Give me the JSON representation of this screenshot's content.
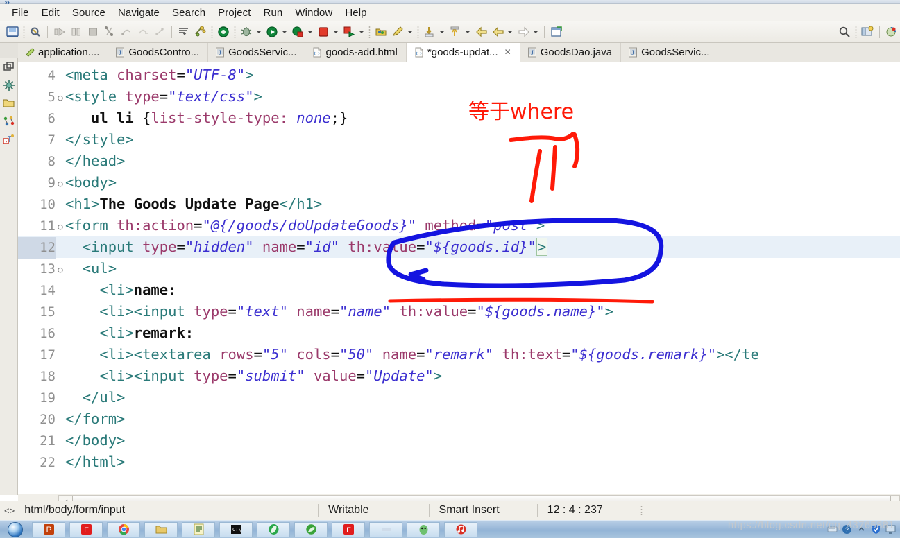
{
  "window": {
    "overflow_chevron": "»"
  },
  "menu": {
    "items": [
      {
        "label": "File",
        "accel": "F"
      },
      {
        "label": "Edit",
        "accel": "E"
      },
      {
        "label": "Source",
        "accel": "S"
      },
      {
        "label": "Navigate",
        "accel": "N"
      },
      {
        "label": "Search",
        "accel": "a"
      },
      {
        "label": "Project",
        "accel": "P"
      },
      {
        "label": "Run",
        "accel": "R"
      },
      {
        "label": "Window",
        "accel": "W"
      },
      {
        "label": "Help",
        "accel": "H"
      }
    ]
  },
  "toolbar": {
    "icons": [
      "save-icon",
      "quick-access-search-icon",
      "step-over-icon",
      "pause-icon",
      "stop-icon",
      "step-into-icon",
      "step-return-icon",
      "resume-icon",
      "disconnect-icon",
      "open-type-icon",
      "open-task-icon",
      "validate-icon",
      "debug-icon",
      "run-icon",
      "coverage-icon",
      "terminate-icon",
      "run-last-icon",
      "new-java-package-icon",
      "new-annotation-icon",
      "download-icon",
      "upload-icon",
      "back-icon",
      "forward-icon",
      "next-icon",
      "new-window-icon"
    ],
    "right_icons": [
      "search-icon",
      "perspective-icon",
      "java-ee-perspective-icon"
    ]
  },
  "rail": {
    "icons": [
      "restore-icon",
      "package-explorer-icon",
      "project-explorer-icon",
      "outline-icon",
      "servers-icon"
    ]
  },
  "tabs": [
    {
      "label": "application....",
      "icon": "properties-file-icon",
      "active": false,
      "dirty": false,
      "closable": false
    },
    {
      "label": "GoodsContro...",
      "icon": "java-file-icon",
      "active": false,
      "dirty": false,
      "closable": false
    },
    {
      "label": "GoodsServic...",
      "icon": "java-file-icon",
      "active": false,
      "dirty": false,
      "closable": false
    },
    {
      "label": "goods-add.html",
      "icon": "html-file-icon",
      "active": false,
      "dirty": false,
      "closable": false
    },
    {
      "label": "*goods-updat...",
      "icon": "html-file-icon",
      "active": true,
      "dirty": true,
      "closable": true,
      "close_glyph": "✕"
    },
    {
      "label": "GoodsDao.java",
      "icon": "java-file-icon",
      "active": false,
      "dirty": false,
      "closable": false
    },
    {
      "label": "GoodsServic...",
      "icon": "java-file-icon",
      "active": false,
      "dirty": false,
      "closable": false
    }
  ],
  "editor": {
    "highlighted_line": 12,
    "lines": [
      {
        "no": "4",
        "fold": "",
        "indent": 0,
        "tokens": [
          {
            "t": "tg",
            "v": "<meta "
          },
          {
            "t": "at",
            "v": "charset"
          },
          {
            "t": "eq",
            "v": "="
          },
          {
            "t": "st",
            "v": "\"UTF-8\""
          },
          {
            "t": "tg",
            "v": ">"
          }
        ]
      },
      {
        "no": "5",
        "fold": "⊖",
        "indent": 0,
        "tokens": [
          {
            "t": "tg",
            "v": "<style "
          },
          {
            "t": "at",
            "v": "type"
          },
          {
            "t": "eq",
            "v": "="
          },
          {
            "t": "st",
            "v": "\"text/css\""
          },
          {
            "t": "tg",
            "v": ">"
          }
        ]
      },
      {
        "no": "6",
        "fold": "",
        "indent": 0,
        "tokens": [
          {
            "t": "cssel",
            "v": "   ul li "
          },
          {
            "t": "eq",
            "v": "{"
          },
          {
            "t": "cssp",
            "v": "list-style-type: "
          },
          {
            "t": "cssv",
            "v": "none"
          },
          {
            "t": "eq",
            "v": ";}"
          }
        ]
      },
      {
        "no": "7",
        "fold": "",
        "indent": 0,
        "tokens": [
          {
            "t": "tg",
            "v": "</style>"
          }
        ]
      },
      {
        "no": "8",
        "fold": "",
        "indent": 0,
        "tokens": [
          {
            "t": "tg",
            "v": "</head>"
          }
        ]
      },
      {
        "no": "9",
        "fold": "⊖",
        "indent": 0,
        "tokens": [
          {
            "t": "tg",
            "v": "<body>"
          }
        ]
      },
      {
        "no": "10",
        "fold": "",
        "indent": 0,
        "tokens": [
          {
            "t": "tg",
            "v": "<h1>"
          },
          {
            "t": "txt",
            "v": "The Goods Update Page"
          },
          {
            "t": "tg",
            "v": "</h1>"
          }
        ]
      },
      {
        "no": "11",
        "fold": "⊖",
        "indent": 0,
        "tokens": [
          {
            "t": "tg",
            "v": "<form "
          },
          {
            "t": "at",
            "v": "th:action"
          },
          {
            "t": "eq",
            "v": "="
          },
          {
            "t": "st",
            "v": "\"@{/goods/doUpdateGoods}\""
          },
          {
            "t": "eq",
            "v": " "
          },
          {
            "t": "at",
            "v": "method"
          },
          {
            "t": "eq",
            "v": "="
          },
          {
            "t": "st",
            "v": "\"post\""
          },
          {
            "t": "tg",
            "v": ">"
          }
        ]
      },
      {
        "no": "12",
        "fold": "",
        "indent": 1,
        "caret": true,
        "tokens": [
          {
            "t": "tg",
            "v": "<input "
          },
          {
            "t": "at",
            "v": "type"
          },
          {
            "t": "eq",
            "v": "="
          },
          {
            "t": "st",
            "v": "\"hidden\""
          },
          {
            "t": "eq",
            "v": " "
          },
          {
            "t": "at",
            "v": "name"
          },
          {
            "t": "eq",
            "v": "="
          },
          {
            "t": "st",
            "v": "\"id\""
          },
          {
            "t": "eq",
            "v": " "
          },
          {
            "t": "at",
            "v": "th:value"
          },
          {
            "t": "eq",
            "v": "="
          },
          {
            "t": "st",
            "v": "\"${goods.id}\""
          },
          {
            "t": "gbox",
            "v": ">"
          }
        ]
      },
      {
        "no": "13",
        "fold": "⊖",
        "indent": 1,
        "tokens": [
          {
            "t": "tg",
            "v": "<ul>"
          }
        ]
      },
      {
        "no": "14",
        "fold": "",
        "indent": 2,
        "tokens": [
          {
            "t": "tg",
            "v": "<li>"
          },
          {
            "t": "txt",
            "v": "name:"
          }
        ]
      },
      {
        "no": "15",
        "fold": "",
        "indent": 2,
        "tokens": [
          {
            "t": "tg",
            "v": "<li><input "
          },
          {
            "t": "at",
            "v": "type"
          },
          {
            "t": "eq",
            "v": "="
          },
          {
            "t": "st",
            "v": "\"text\""
          },
          {
            "t": "eq",
            "v": " "
          },
          {
            "t": "at",
            "v": "name"
          },
          {
            "t": "eq",
            "v": "="
          },
          {
            "t": "st",
            "v": "\"name\""
          },
          {
            "t": "eq",
            "v": " "
          },
          {
            "t": "at",
            "v": "th:value"
          },
          {
            "t": "eq",
            "v": "="
          },
          {
            "t": "st",
            "v": "\"${goods.name}\""
          },
          {
            "t": "tg",
            "v": ">"
          }
        ]
      },
      {
        "no": "16",
        "fold": "",
        "indent": 2,
        "tokens": [
          {
            "t": "tg",
            "v": "<li>"
          },
          {
            "t": "txt",
            "v": "remark:"
          }
        ]
      },
      {
        "no": "17",
        "fold": "",
        "indent": 2,
        "tokens": [
          {
            "t": "tg",
            "v": "<li><textarea "
          },
          {
            "t": "at",
            "v": "rows"
          },
          {
            "t": "eq",
            "v": "="
          },
          {
            "t": "st",
            "v": "\"5\""
          },
          {
            "t": "eq",
            "v": " "
          },
          {
            "t": "at",
            "v": "cols"
          },
          {
            "t": "eq",
            "v": "="
          },
          {
            "t": "st",
            "v": "\"50\""
          },
          {
            "t": "eq",
            "v": " "
          },
          {
            "t": "at",
            "v": "name"
          },
          {
            "t": "eq",
            "v": "="
          },
          {
            "t": "st",
            "v": "\"remark\""
          },
          {
            "t": "eq",
            "v": " "
          },
          {
            "t": "at",
            "v": "th:text"
          },
          {
            "t": "eq",
            "v": "="
          },
          {
            "t": "st",
            "v": "\"${goods.remark}\""
          },
          {
            "t": "tg",
            "v": "></te"
          }
        ]
      },
      {
        "no": "18",
        "fold": "",
        "indent": 2,
        "tokens": [
          {
            "t": "tg",
            "v": "<li><input "
          },
          {
            "t": "at",
            "v": "type"
          },
          {
            "t": "eq",
            "v": "="
          },
          {
            "t": "st",
            "v": "\"submit\""
          },
          {
            "t": "eq",
            "v": " "
          },
          {
            "t": "at",
            "v": "value"
          },
          {
            "t": "eq",
            "v": "="
          },
          {
            "t": "st",
            "v": "\"Update\""
          },
          {
            "t": "tg",
            "v": ">"
          }
        ]
      },
      {
        "no": "19",
        "fold": "",
        "indent": 1,
        "tokens": [
          {
            "t": "tg",
            "v": "</ul>"
          }
        ]
      },
      {
        "no": "20",
        "fold": "",
        "indent": 0,
        "tokens": [
          {
            "t": "tg",
            "v": "</form>"
          }
        ]
      },
      {
        "no": "21",
        "fold": "",
        "indent": 0,
        "tokens": [
          {
            "t": "tg",
            "v": "</body>"
          }
        ]
      },
      {
        "no": "22",
        "fold": "",
        "indent": 0,
        "tokens": [
          {
            "t": "tg",
            "v": "</html>"
          }
        ]
      }
    ]
  },
  "annotations": {
    "red_text": "等于where",
    "red_color": "#ff1a08",
    "blue_color": "#1414e0",
    "shapes": [
      "red-arrow-scribble",
      "blue-ellipse-highlight",
      "red-underline"
    ]
  },
  "scrollbar": {
    "left_arrow": "◄",
    "right_arrow": "►"
  },
  "statusbar": {
    "breadcrumb_icon": "<>",
    "breadcrumb": "html/body/form/input",
    "writable": "Writable",
    "insert_mode": "Smart Insert",
    "position": "12 : 4 : 237"
  },
  "taskbar": {
    "start": "start-orb",
    "buttons": [
      "powerpoint-icon",
      "format-factory-icon",
      "chrome-icon",
      "folder-icon",
      "notes-icon",
      "cmd-icon",
      "green-pill-icon",
      "leaf-icon",
      "format-factory-2-icon",
      "blank-icon",
      "qq-icon",
      "music-icon"
    ],
    "tray": [
      "keyboard-icon",
      "help-icon",
      "chevron-up-icon",
      "shield-icon",
      "screen-icon"
    ]
  },
  "watermark": "https://blog.csdn.net/qq_43765881"
}
